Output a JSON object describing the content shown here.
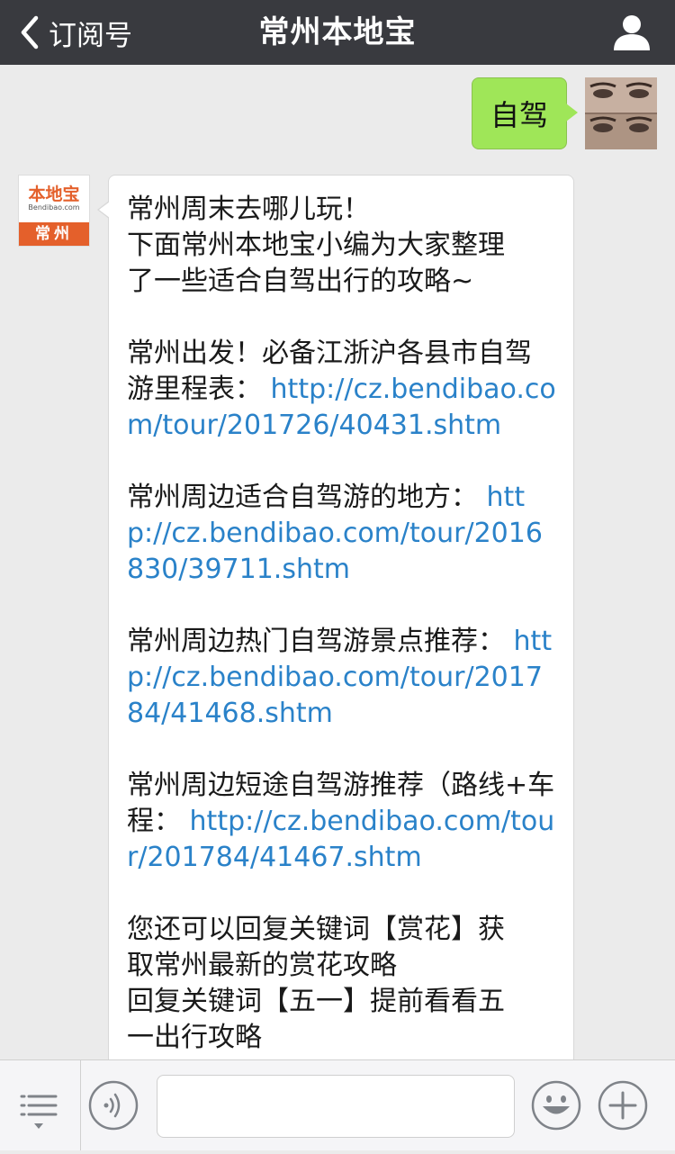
{
  "navbar": {
    "back_label": "订阅号",
    "title": "常州本地宝",
    "background": "#393a3f"
  },
  "outgoing": {
    "text": "自驾",
    "bubble_color": "#9fe658"
  },
  "bot": {
    "avatar": {
      "brand": "本地宝",
      "domain": "Bendibao.com",
      "city": "常州"
    },
    "paragraphs": [
      {
        "lines": [
          "常州周末去哪儿玩！",
          "下面常州本地宝小编为大家整理",
          "了一些适合自驾出行的攻略~"
        ]
      },
      {
        "text": "常州出发！必备江浙沪各县市自驾游里程表：",
        "link": "http://cz.bendibao.com/tour/201726/40431.shtm"
      },
      {
        "text": "常州周边适合自驾游的地方：",
        "link": "http://cz.bendibao.com/tour/2016830/39711.shtm"
      },
      {
        "text": "常州周边热门自驾游景点推荐：",
        "link": "http://cz.bendibao.com/tour/201784/41468.shtm"
      },
      {
        "text": "常州周边短途自驾游推荐（路线+车程：",
        "link": "http://cz.bendibao.com/tour/201784/41467.shtm"
      },
      {
        "lines": [
          "您还可以回复关键词【赏花】获",
          "取常州最新的赏花攻略",
          "回复关键词【五一】提前看看五",
          "一出行攻略"
        ]
      }
    ],
    "link_color": "#2a82c9"
  },
  "input": {
    "value": "",
    "placeholder": ""
  },
  "icons": [
    "back-chevron-icon",
    "profile-icon",
    "menu-list-icon",
    "voice-icon",
    "emoji-icon",
    "plus-icon"
  ]
}
